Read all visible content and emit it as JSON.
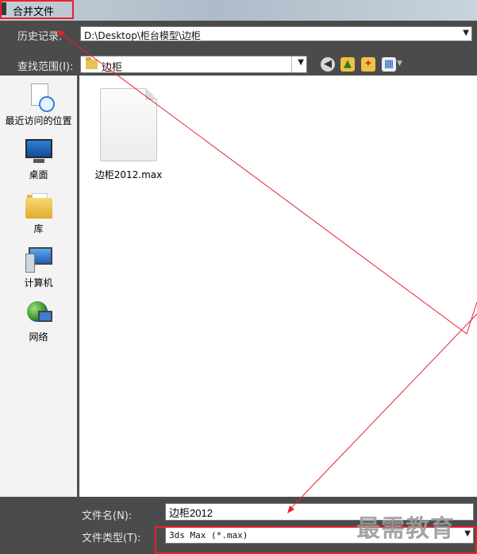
{
  "dialog": {
    "title": "合并文件"
  },
  "history": {
    "label": "历史记录:",
    "path": "D:\\Desktop\\柜台模型\\边柜"
  },
  "look_in": {
    "label": "查找范围(I):",
    "folder": "边柜"
  },
  "toolbar": {
    "back_icon": "back-arrow-icon",
    "up_icon": "up-folder-icon",
    "new_folder_icon": "new-folder-icon",
    "views_icon": "view-menu-icon"
  },
  "places": [
    {
      "label": "最近访问的位置",
      "icon": "recent-places-icon"
    },
    {
      "label": "桌面",
      "icon": "desktop-icon"
    },
    {
      "label": "库",
      "icon": "libraries-icon"
    },
    {
      "label": "计算机",
      "icon": "computer-icon"
    },
    {
      "label": "网络",
      "icon": "network-icon"
    }
  ],
  "files": [
    {
      "name": "边柜2012.max",
      "icon": "max-file-icon"
    }
  ],
  "file_name": {
    "label": "文件名(N):",
    "value": "边柜2012"
  },
  "file_type": {
    "label": "文件类型(T):",
    "value": "3ds Max (*.max)"
  },
  "watermark": "最需教育",
  "colors": {
    "highlight_red": "#e8222e",
    "panel_dark": "#4b4b4b"
  }
}
